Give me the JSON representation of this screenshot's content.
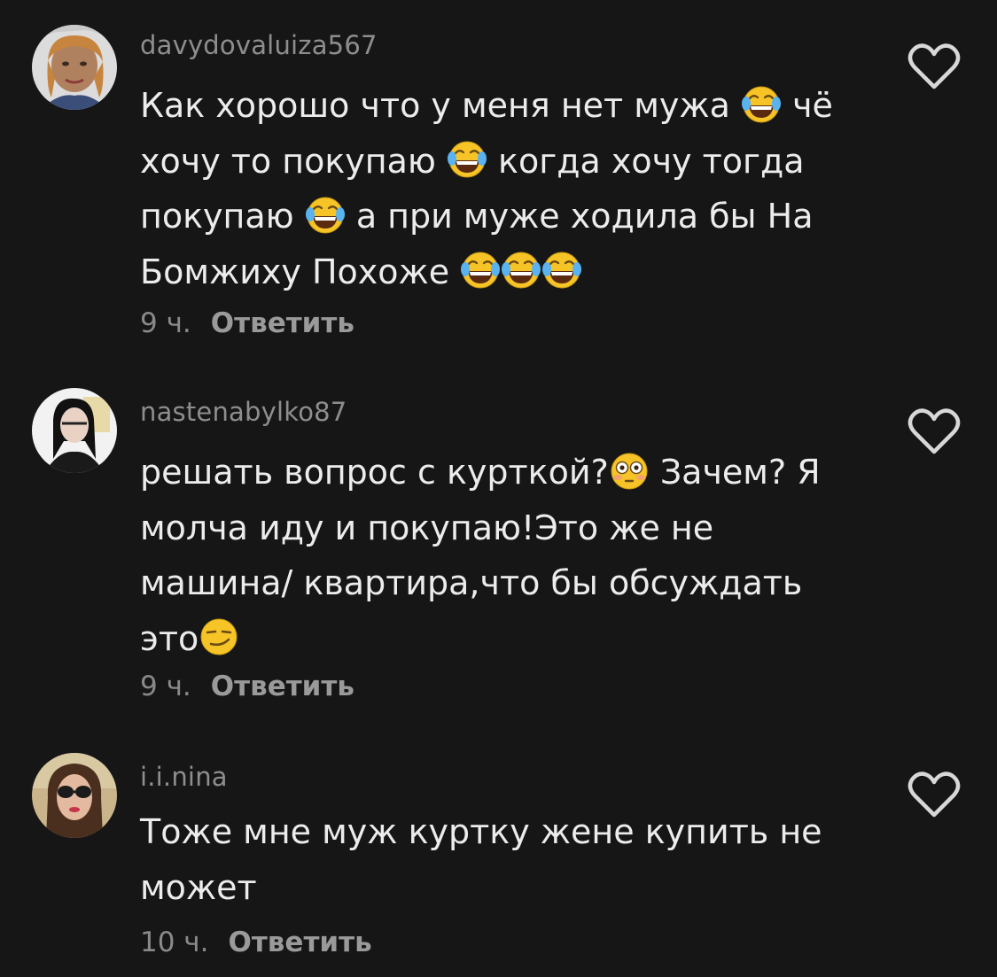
{
  "comments": [
    {
      "username": "davydovaluiza567",
      "lines": [
        [
          {
            "t": "Как хорошо что у меня нет мужа "
          },
          {
            "e": "laugh"
          },
          {
            "t": " чё"
          }
        ],
        [
          {
            "t": "хочу то покупаю "
          },
          {
            "e": "laugh"
          },
          {
            "t": " когда хочу тогда"
          }
        ],
        [
          {
            "t": "покупаю "
          },
          {
            "e": "laugh"
          },
          {
            "t": " а при муже ходила бы На"
          }
        ],
        [
          {
            "t": "Бомжиху Похоже "
          },
          {
            "e": "laugh"
          },
          {
            "e": "laugh"
          },
          {
            "e": "laugh"
          }
        ]
      ],
      "time": "9 ч.",
      "reply_label": "Ответить",
      "avatar_icon": "profile-photo-woman"
    },
    {
      "username": "nastenabylko87",
      "lines": [
        [
          {
            "t": "решать вопрос с курткой?"
          },
          {
            "e": "flushed"
          },
          {
            "t": " Зачем? Я"
          }
        ],
        [
          {
            "t": "молча иду и покупаю!Это же не"
          }
        ],
        [
          {
            "t": "машина/ квартира,что бы обсуждать"
          }
        ],
        [
          {
            "t": "это"
          },
          {
            "e": "smirk"
          }
        ]
      ],
      "time": "9 ч.",
      "reply_label": "Ответить",
      "avatar_icon": "profile-photo-woman"
    },
    {
      "username": "i.i.nina",
      "lines": [
        [
          {
            "t": "Тоже мне муж куртку жене купить не"
          }
        ],
        [
          {
            "t": "может"
          }
        ]
      ],
      "time": "10 ч.",
      "reply_label": "Ответить",
      "avatar_icon": "profile-photo-woman-sunglasses"
    }
  ],
  "icons": {
    "like": "heart-outline-icon",
    "laugh": "face-with-tears-of-joy-emoji",
    "flushed": "flushed-face-emoji",
    "smirk": "smirking-face-emoji"
  },
  "colors": {
    "background": "#161616",
    "text": "#ececec",
    "username": "#8e8e8e",
    "meta": "#8a8a8a",
    "emoji_yellow": "#f7c428"
  }
}
